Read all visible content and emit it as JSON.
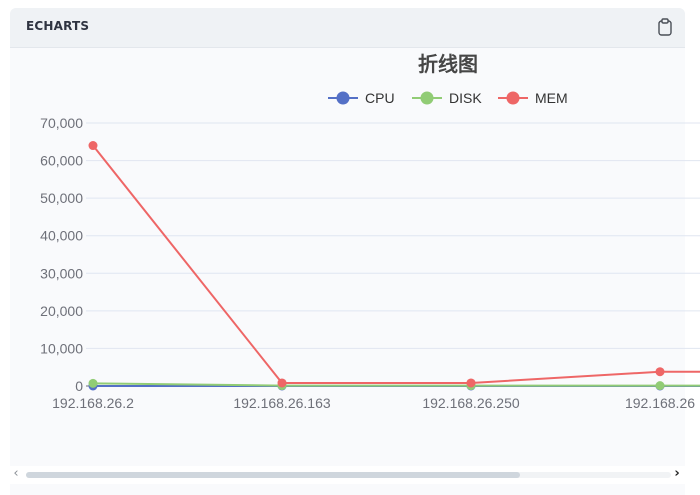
{
  "panel": {
    "title": "ECHARTS",
    "copy_icon": "clipboard-icon"
  },
  "colors": {
    "CPU": "#5470c6",
    "DISK": "#91cc75",
    "MEM": "#ee6666",
    "grid": "#e0e6f1",
    "axis_text": "#6e7079",
    "title": "#464646",
    "legend_text": "#333333"
  },
  "chart_data": {
    "type": "line",
    "title": "折线图",
    "categories": [
      "192.168.26.2",
      "192.168.26.163",
      "192.168.26.250",
      "192.168.26"
    ],
    "series": [
      {
        "name": "CPU",
        "values": [
          0,
          0,
          0,
          0
        ]
      },
      {
        "name": "DISK",
        "values": [
          700,
          100,
          100,
          100
        ]
      },
      {
        "name": "MEM",
        "values": [
          64000,
          800,
          800,
          3800
        ]
      }
    ],
    "ylim": [
      0,
      70000
    ],
    "yticks": [
      "0",
      "10,000",
      "20,000",
      "30,000",
      "40,000",
      "50,000",
      "60,000",
      "70,000"
    ],
    "xlabel": "",
    "ylabel": "",
    "grid": true,
    "legend_position": "top-center"
  }
}
